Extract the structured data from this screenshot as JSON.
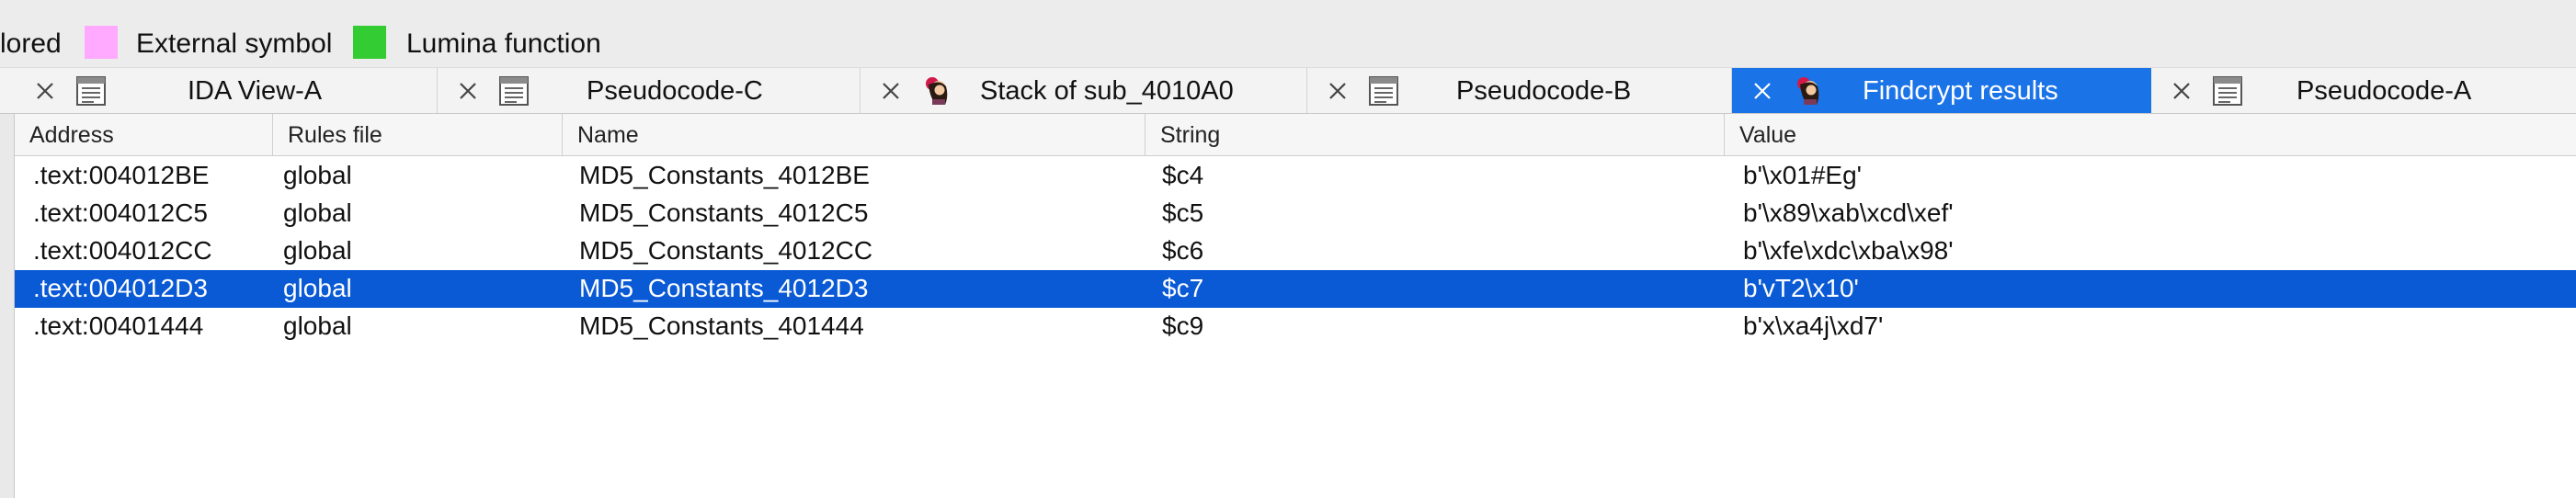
{
  "legend": {
    "items": [
      {
        "label": "lored",
        "color": ""
      },
      {
        "label": "External symbol",
        "color": "#ffaaff"
      },
      {
        "label": "Lumina function",
        "color": "#33cc33"
      }
    ]
  },
  "tabs": [
    {
      "label": "IDA View-A",
      "icon": "disassembly-view-icon",
      "active": false
    },
    {
      "label": "Pseudocode-C",
      "icon": "disassembly-view-icon",
      "active": false
    },
    {
      "label": "Stack of sub_4010A0",
      "icon": "ida-lady-icon",
      "active": false
    },
    {
      "label": "Pseudocode-B",
      "icon": "disassembly-view-icon",
      "active": false
    },
    {
      "label": "Findcrypt results",
      "icon": "ida-lady-icon",
      "active": true
    },
    {
      "label": "Pseudocode-A",
      "icon": "disassembly-view-icon",
      "active": false
    }
  ],
  "table": {
    "columns": [
      "Address",
      "Rules file",
      "Name",
      "String",
      "Value"
    ],
    "rows": [
      [
        ".text:004012BE",
        "global",
        "MD5_Constants_4012BE",
        "$c4",
        "b'\\x01#Eg'"
      ],
      [
        ".text:004012C5",
        "global",
        "MD5_Constants_4012C5",
        "$c5",
        "b'\\x89\\xab\\xcd\\xef'"
      ],
      [
        ".text:004012CC",
        "global",
        "MD5_Constants_4012CC",
        "$c6",
        "b'\\xfe\\xdc\\xba\\x98'"
      ],
      [
        ".text:004012D3",
        "global",
        "MD5_Constants_4012D3",
        "$c7",
        "b'vT2\\x10'"
      ],
      [
        ".text:00401444",
        "global",
        "MD5_Constants_401444",
        "$c9",
        "b'x\\xa4j\\xd7'"
      ]
    ],
    "selected_row": 3
  },
  "colors": {
    "tab_active": "#1b73e8",
    "row_selected": "#0a5ad6"
  }
}
